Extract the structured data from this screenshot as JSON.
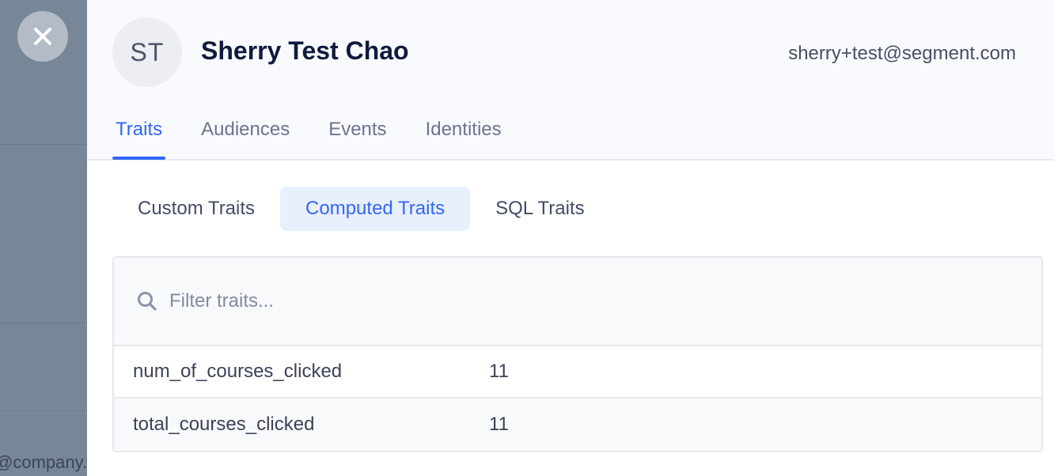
{
  "backdrop": {
    "peek_text": "@company."
  },
  "close_button": {
    "icon": "close-icon"
  },
  "profile": {
    "initials": "ST",
    "name": "Sherry Test Chao",
    "email": "sherry+test@segment.com"
  },
  "main_tabs": [
    {
      "label": "Traits",
      "active": true
    },
    {
      "label": "Audiences",
      "active": false
    },
    {
      "label": "Events",
      "active": false
    },
    {
      "label": "Identities",
      "active": false
    }
  ],
  "sub_tabs": [
    {
      "label": "Custom Traits",
      "active": false
    },
    {
      "label": "Computed Traits",
      "active": true
    },
    {
      "label": "SQL Traits",
      "active": false
    }
  ],
  "search": {
    "icon": "search-icon",
    "placeholder": "Filter traits...",
    "value": ""
  },
  "traits": [
    {
      "key": "num_of_courses_clicked",
      "value": "11"
    },
    {
      "key": "total_courses_clicked",
      "value": "11"
    }
  ],
  "colors": {
    "accent": "#3367f5",
    "active_subtab_bg": "#e8effd",
    "backdrop": "#778797"
  }
}
